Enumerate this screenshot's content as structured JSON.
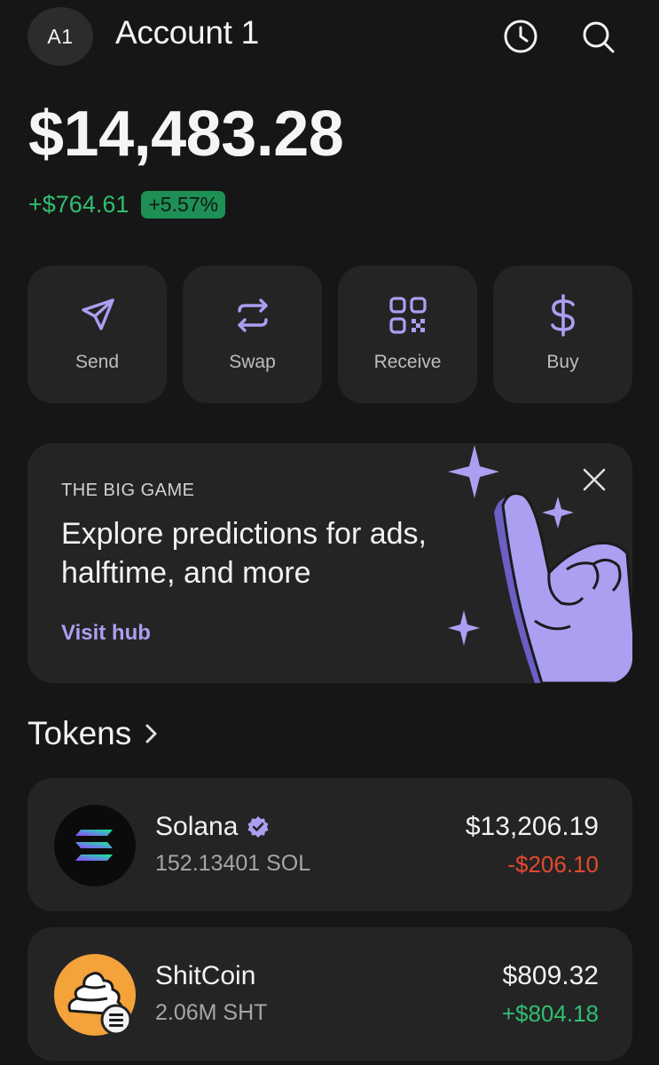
{
  "header": {
    "avatar_initials": "A1",
    "account_name": "Account 1",
    "history_icon": "clock-icon",
    "search_icon": "search-icon"
  },
  "balance": {
    "total": "$14,483.28",
    "change_amount": "+$764.61",
    "change_percent": "+5.57%"
  },
  "actions": [
    {
      "label": "Send",
      "icon": "send-icon"
    },
    {
      "label": "Swap",
      "icon": "swap-icon"
    },
    {
      "label": "Receive",
      "icon": "qr-code-icon"
    },
    {
      "label": "Buy",
      "icon": "dollar-icon"
    }
  ],
  "promo": {
    "eyebrow": "THE BIG GAME",
    "title": "Explore predictions for ads, halftime, and more",
    "link": "Visit hub"
  },
  "tokens": {
    "section_title": "Tokens",
    "items": [
      {
        "name": "Solana",
        "amount": "152.13401 SOL",
        "value": "$13,206.19",
        "change": "-$206.10",
        "verified": true
      },
      {
        "name": "ShitCoin",
        "amount": "2.06M SHT",
        "value": "$809.32",
        "change": "+$804.18",
        "verified": false
      }
    ]
  },
  "colors": {
    "accent": "#ab9ff2",
    "positive": "#2fbf71",
    "negative": "#e4492e",
    "card": "#242424",
    "background": "#161616"
  }
}
